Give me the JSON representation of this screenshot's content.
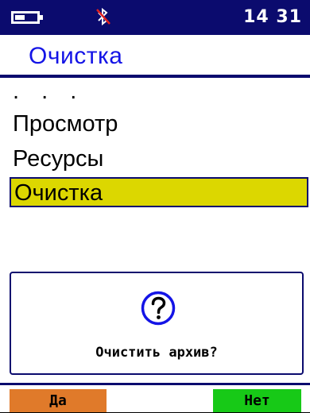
{
  "status_bar": {
    "time": "14 31",
    "icons": [
      "battery-icon",
      "bluetooth-off-icon"
    ]
  },
  "title": "Очистка",
  "menu": {
    "items": [
      {
        "label": ". . .",
        "selected": false
      },
      {
        "label": "Просмотр",
        "selected": false
      },
      {
        "label": "Ресурсы",
        "selected": false
      },
      {
        "label": "Очистка",
        "selected": true
      }
    ]
  },
  "dialog": {
    "icon": "question-icon",
    "message": "Очистить архив?"
  },
  "softkeys": {
    "yes": "Да",
    "no": "Нет"
  },
  "colors": {
    "status_bar": "#0b0b6e",
    "title": "#1414e6",
    "selection": "#dcd700",
    "yes_button": "#e07a2a",
    "no_button": "#17c917"
  }
}
